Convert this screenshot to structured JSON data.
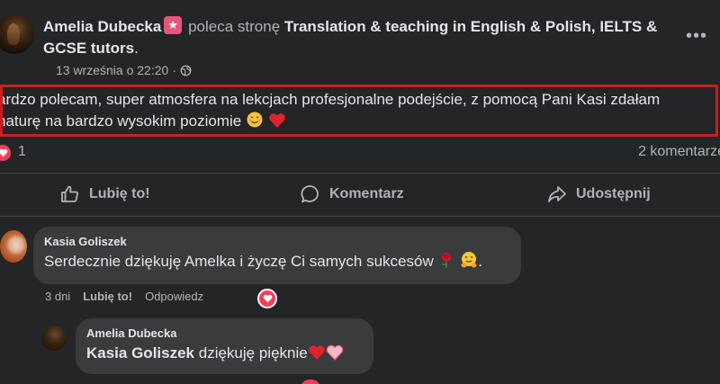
{
  "post": {
    "author": "Amelia Dubecka",
    "verb": "poleca stronę",
    "page_name": "Translation & teaching in English & Polish, IELTS & GCSE tutors",
    "page_suffix": ".",
    "timestamp": "13 września o 22:20",
    "separator": "·",
    "more": "•••",
    "body_line1": "ardzo polecam, super atmosfera na lekcjach profesjonalne podejście, z pomocą Pani Kasi zdałam",
    "body_line2": "naturę na bardzo wysokim poziomie",
    "reaction_count": "1",
    "comments_count": "2 komentarze"
  },
  "actions": {
    "like": "Lubię to!",
    "comment": "Komentarz",
    "share": "Udostępnij"
  },
  "comments": [
    {
      "author": "Kasia Goliszek",
      "text": "Serdecznie dziękuję Amelka i życzę Ci samych sukcesów",
      "suffix": ".",
      "time": "3 dni",
      "like": "Lubię to!",
      "reply": "Odpowiedz"
    },
    {
      "author": "Amelia Dubecka",
      "mention": "Kasia Goliszek",
      "text": "dziękuję pięknie"
    }
  ],
  "colors": {
    "background": "#242526",
    "bubble": "#3a3b3c",
    "highlight_border": "#c81e1e",
    "heart": "#f33e58",
    "badge": "#e9547a"
  },
  "icons": [
    "star-badge-icon",
    "globe-icon",
    "more-icon",
    "heart-icon",
    "thumbs-up-icon",
    "comment-icon",
    "share-icon",
    "rose-icon",
    "hug-emoji-icon",
    "smiling-face-emoji-icon"
  ]
}
